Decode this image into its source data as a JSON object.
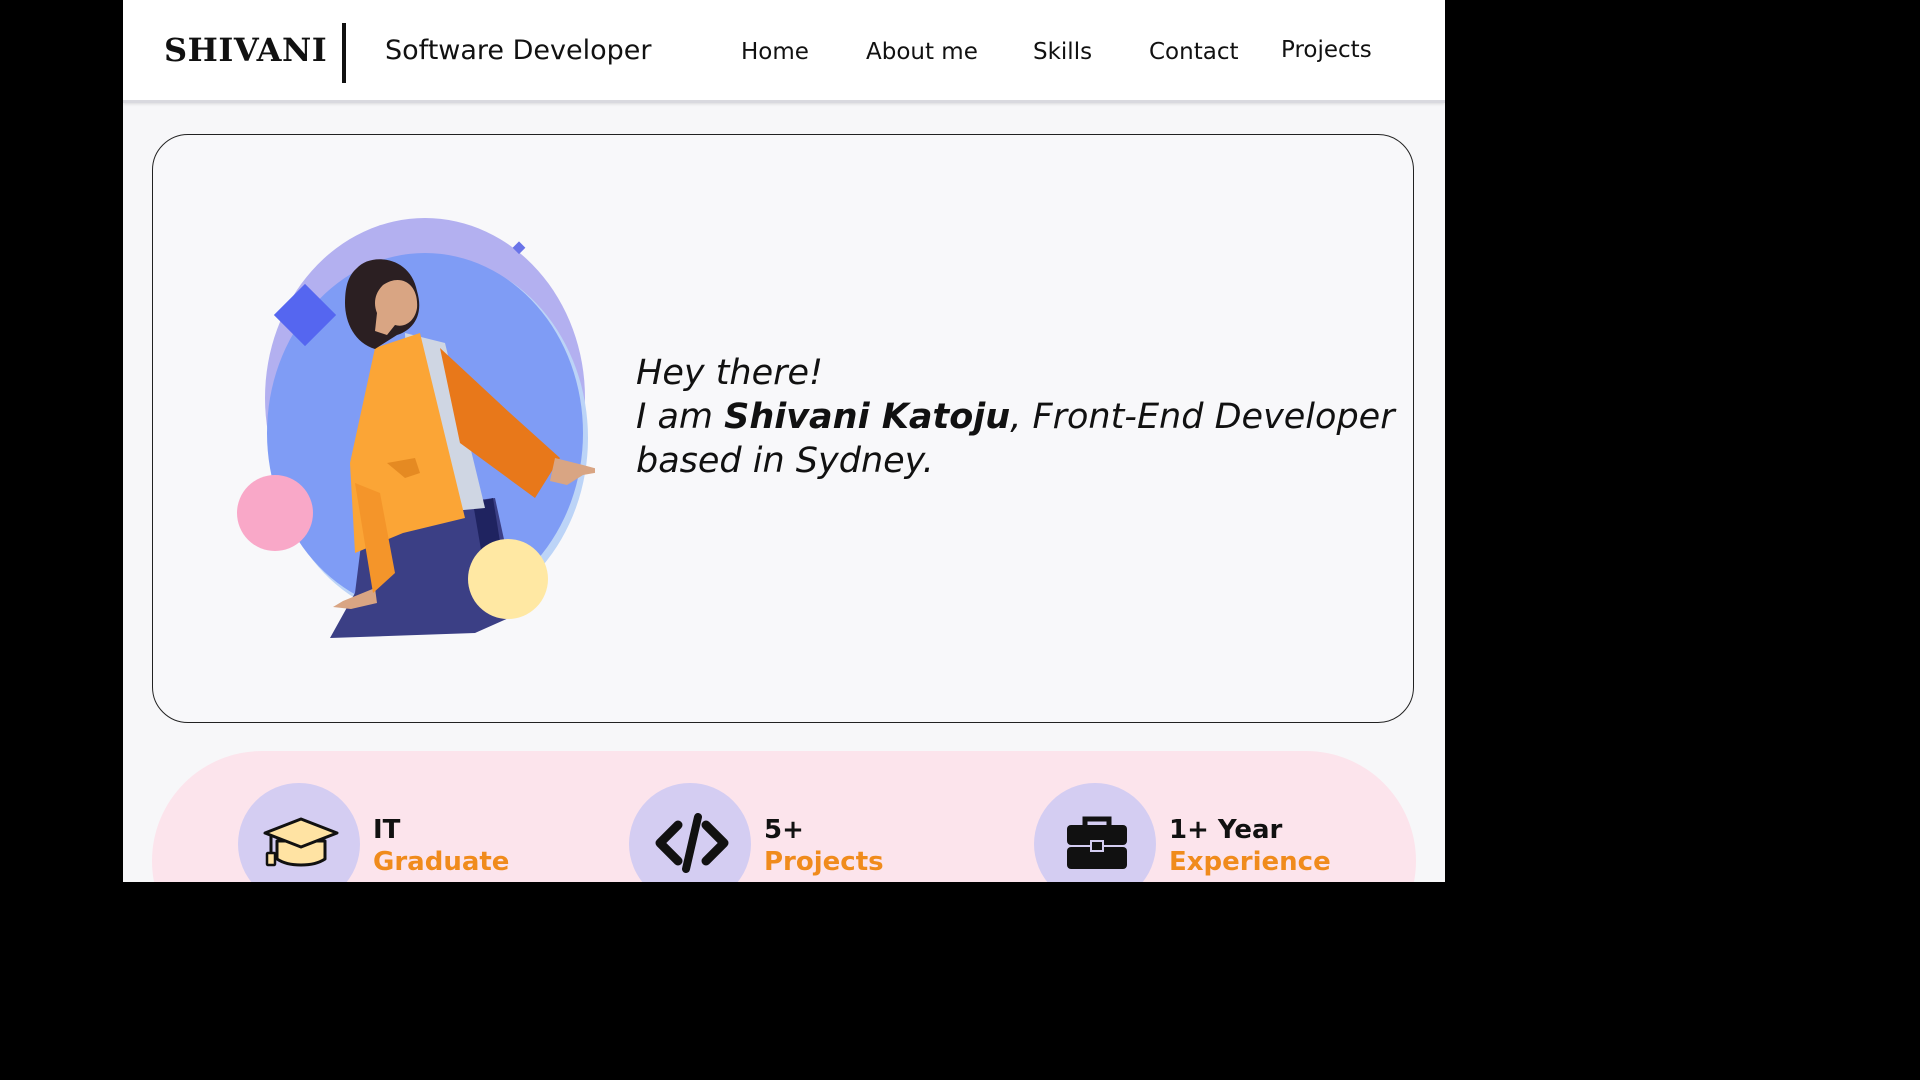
{
  "header": {
    "logo": "SHIVANI",
    "tagline": "Software Developer",
    "nav": [
      "Home",
      "About me",
      "Skills",
      "Contact",
      "Projects"
    ]
  },
  "hero": {
    "greeting": "Hey there!",
    "intro_prefix": "I am ",
    "name": "Shivani Katoju",
    "intro_suffix": ", Front-End Developer",
    "intro_line3": "based in Sydney."
  },
  "stats": [
    {
      "icon": "graduation-cap-icon",
      "title": "IT",
      "subtitle": "Graduate"
    },
    {
      "icon": "code-icon",
      "title": "5+",
      "subtitle": "Projects"
    },
    {
      "icon": "briefcase-icon",
      "title": "1+ Year",
      "subtitle": "Experience"
    }
  ],
  "colors": {
    "accent": "#f08b1c",
    "stats_bg": "#fce4ec",
    "icon_circle": "#d4cdf2",
    "illustration_blue": "#7f9cf5",
    "illustration_lavender": "#b3b0f0"
  }
}
